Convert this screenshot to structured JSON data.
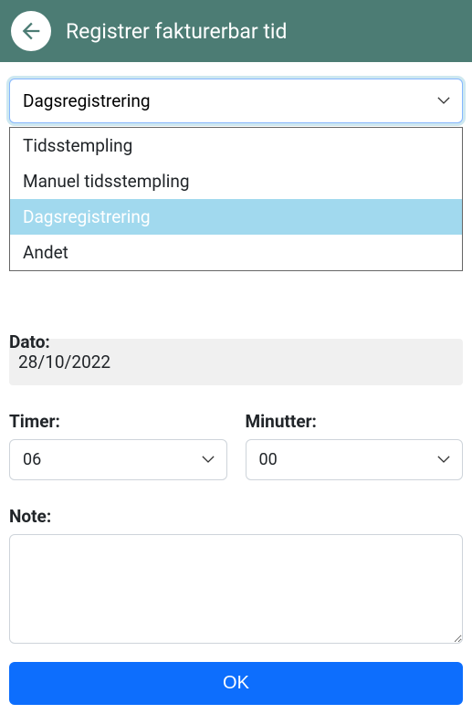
{
  "header": {
    "title": "Registrer fakturerbar tid"
  },
  "mainSelect": {
    "value": "Dagsregistrering",
    "options": [
      "Tidsstempling",
      "Manuel tidsstempling",
      "Dagsregistrering",
      "Andet"
    ],
    "selectedIndex": 2
  },
  "dateSection": {
    "label": "Dato:",
    "value": "28/10/2022"
  },
  "hours": {
    "label": "Timer:",
    "value": "06"
  },
  "minutes": {
    "label": "Minutter:",
    "value": "00"
  },
  "note": {
    "label": "Note:",
    "value": ""
  },
  "okButton": {
    "label": "OK"
  }
}
